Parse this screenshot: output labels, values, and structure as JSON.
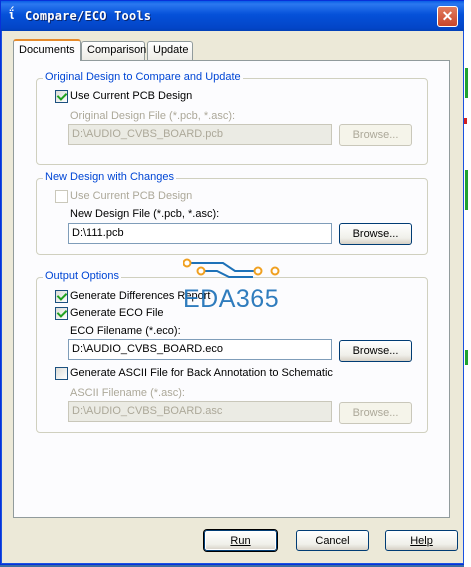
{
  "window": {
    "title": "Compare/ECO Tools",
    "close_glyph": "✕"
  },
  "tabs": [
    {
      "label": "Documents"
    },
    {
      "label": "Comparison"
    },
    {
      "label": "Update"
    }
  ],
  "original": {
    "legend": "Original Design to Compare and Update",
    "use_current_label": "Use Current PCB Design",
    "use_current_checked": true,
    "file_label": "Original Design File (*.pcb, *.asc):",
    "file_value": "D:\\AUDIO_CVBS_BOARD.pcb",
    "browse_label": "Browse..."
  },
  "newdesign": {
    "legend": "New Design with Changes",
    "use_current_label": "Use Current PCB Design",
    "use_current_checked": false,
    "file_label": "New Design File (*.pcb, *.asc):",
    "file_value": "D:\\111.pcb",
    "browse_label": "Browse..."
  },
  "output": {
    "legend": "Output Options",
    "gen_diff_label": "Generate Differences Report",
    "gen_diff_checked": true,
    "gen_eco_label": "Generate ECO File",
    "gen_eco_checked": true,
    "eco_filename_label": "ECO Filename (*.eco):",
    "eco_filename_value": "D:\\AUDIO_CVBS_BOARD.eco",
    "eco_browse_label": "Browse...",
    "gen_ascii_label": "Generate ASCII File for Back Annotation to Schematic",
    "gen_ascii_checked": false,
    "ascii_filename_label": "ASCII Filename (*.asc):",
    "ascii_filename_value": "D:\\AUDIO_CVBS_BOARD.asc",
    "ascii_browse_label": "Browse..."
  },
  "watermark": {
    "text": "EDA365"
  },
  "buttons": {
    "run": "Run",
    "cancel": "Cancel",
    "help": "Help"
  },
  "colors": {
    "accent": "#0046d5",
    "titlebar": "#0551d9",
    "tab_highlight": "#e68b2c"
  }
}
